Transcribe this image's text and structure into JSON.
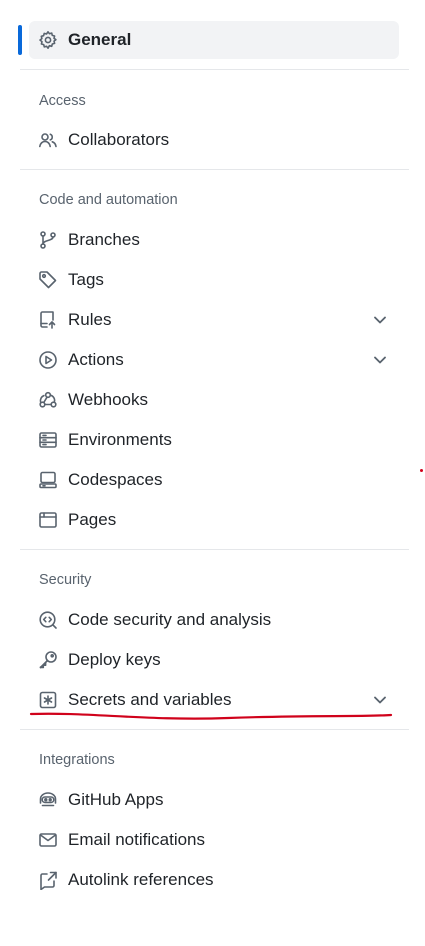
{
  "nav": {
    "general": {
      "label": "General",
      "icon": "gear-icon"
    },
    "sections": [
      {
        "heading": "Access",
        "items": [
          {
            "label": "Collaborators",
            "icon": "people-icon"
          }
        ]
      },
      {
        "heading": "Code and automation",
        "items": [
          {
            "label": "Branches",
            "icon": "git-branch-icon"
          },
          {
            "label": "Tags",
            "icon": "tag-icon"
          },
          {
            "label": "Rules",
            "icon": "repo-push-icon",
            "expandable": true
          },
          {
            "label": "Actions",
            "icon": "play-icon",
            "expandable": true
          },
          {
            "label": "Webhooks",
            "icon": "webhook-icon"
          },
          {
            "label": "Environments",
            "icon": "server-icon"
          },
          {
            "label": "Codespaces",
            "icon": "codespaces-icon"
          },
          {
            "label": "Pages",
            "icon": "browser-icon"
          }
        ]
      },
      {
        "heading": "Security",
        "items": [
          {
            "label": "Code security and analysis",
            "icon": "codescan-icon"
          },
          {
            "label": "Deploy keys",
            "icon": "key-icon"
          },
          {
            "label": "Secrets and variables",
            "icon": "key-asterisk-icon",
            "expandable": true
          }
        ]
      },
      {
        "heading": "Integrations",
        "items": [
          {
            "label": "GitHub Apps",
            "icon": "hubot-icon"
          },
          {
            "label": "Email notifications",
            "icon": "mail-icon"
          },
          {
            "label": "Autolink references",
            "icon": "cross-reference-icon"
          }
        ]
      }
    ]
  },
  "colors": {
    "accent": "#0969da",
    "annotation_red": "#d0021b",
    "active_bg": "#f2f3f5",
    "muted_text": "#59636e"
  }
}
